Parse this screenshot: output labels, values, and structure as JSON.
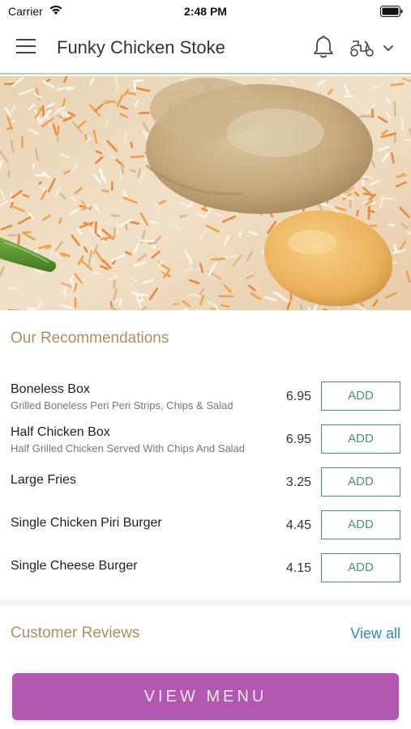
{
  "status_bar": {
    "carrier": "Carrier",
    "time": "2:48 PM"
  },
  "header": {
    "title": "Funky Chicken Stoke",
    "icons": [
      "hamburger-menu-icon",
      "bell-icon",
      "scooter-icon",
      "chevron-down-icon"
    ]
  },
  "hero": {
    "image": "chicken biryani dish with rice, carrots, chicken piece, potato and green chilli"
  },
  "recommendations": {
    "title": "Our Recommendations",
    "add_label": "ADD",
    "items": [
      {
        "name": "Boneless Box",
        "description": "Grilled Boneless Peri Peri Strips, Chips & Salad",
        "price": "6.95"
      },
      {
        "name": "Half Chicken Box",
        "description": "Half Grilled Chicken Served With Chips And Salad",
        "price": "6.95"
      },
      {
        "name": "Large Fries",
        "description": "",
        "price": "3.25"
      },
      {
        "name": "Single Chicken Piri Burger",
        "description": "",
        "price": "4.45"
      },
      {
        "name": "Single Cheese Burger",
        "description": "",
        "price": "4.15"
      }
    ]
  },
  "reviews": {
    "title": "Customer Reviews",
    "view_all_label": "View all"
  },
  "footer": {
    "view_menu_label": "VIEW MENU"
  },
  "colors": {
    "accent_gold": "#a7925f",
    "add_green": "#3f9a64",
    "link_blue": "#2a8bbf",
    "button_purple": "#b258b0"
  }
}
